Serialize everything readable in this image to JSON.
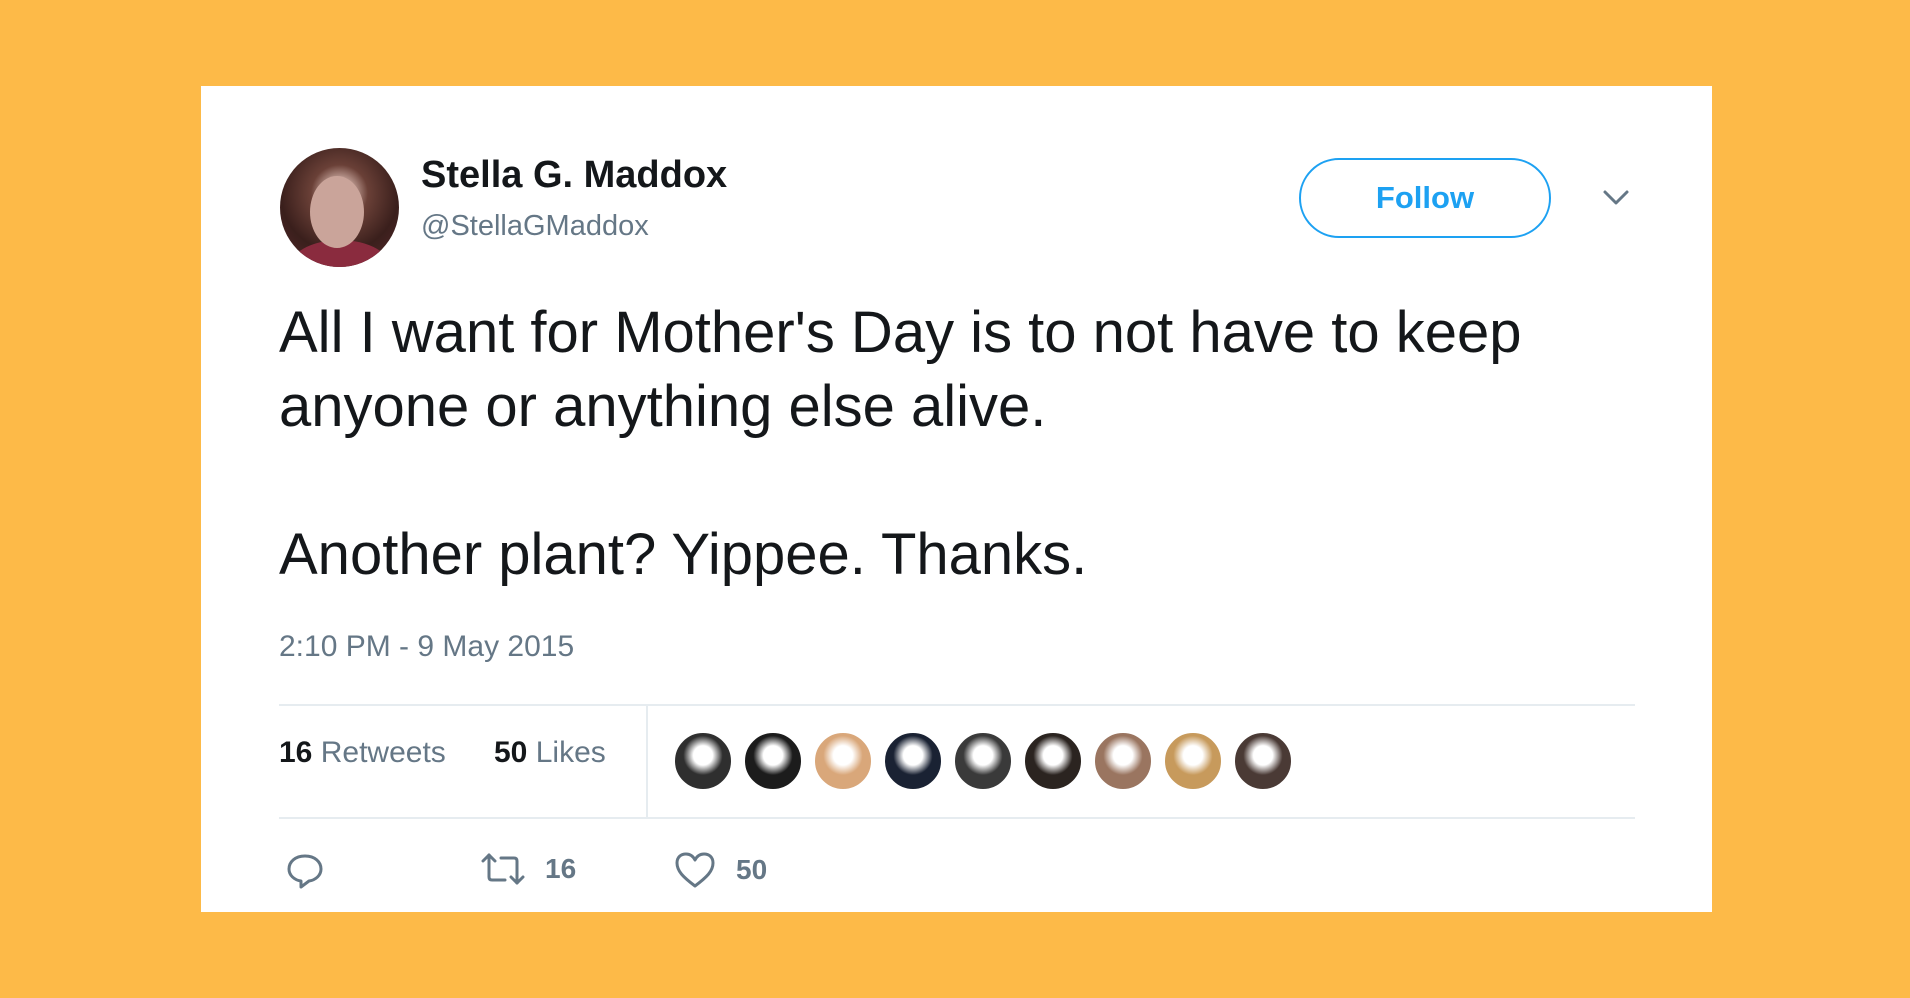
{
  "tweet": {
    "author_name": "Stella G. Maddox",
    "author_handle": "@StellaGMaddox",
    "follow_label": "Follow",
    "text_line1": "All I want for Mother's Day is to not have to keep anyone or anything else alive.",
    "text_line2": "Another plant? Yippee. Thanks.",
    "timestamp": "2:10 PM - 9 May 2015"
  },
  "stats": {
    "retweets_count": "16",
    "retweets_label": "Retweets",
    "likes_count": "50",
    "likes_label": "Likes"
  },
  "likers": [
    "#2f2f2f",
    "#1c1c1c",
    "#d9a77a",
    "#1a2233",
    "#3a3a3a",
    "#2b2420",
    "#9a7560",
    "#c79a5c",
    "#4a3a35"
  ],
  "actions": {
    "reply_icon": "reply-icon",
    "retweet_icon": "retweet-icon",
    "retweet_count": "16",
    "like_icon": "heart-icon",
    "like_count": "50"
  },
  "colors": {
    "background": "#FDBA48",
    "accent": "#1DA1F2",
    "secondary_text": "#657786"
  }
}
